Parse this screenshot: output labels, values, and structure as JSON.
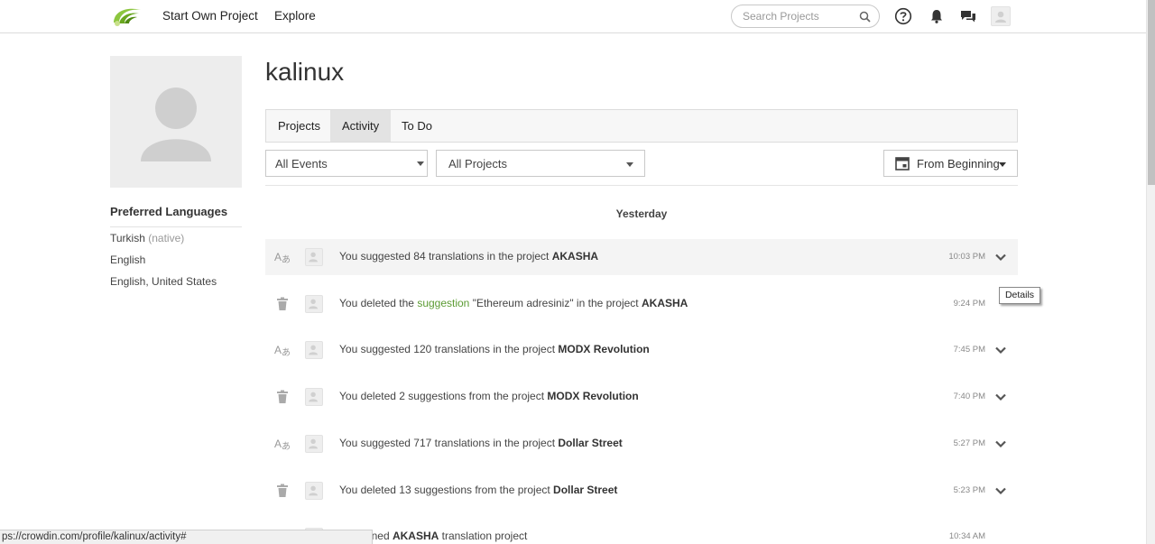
{
  "topbar": {
    "logo_icon": "crowdin-logo-icon",
    "nav": [
      "Start Own Project",
      "Explore"
    ],
    "search_placeholder": "Search Projects",
    "icons": [
      "help-icon",
      "bell-icon",
      "chat-icon"
    ]
  },
  "sidebar": {
    "preferred_languages_title": "Preferred Languages",
    "languages": [
      {
        "name": "Turkish",
        "note": "(native)"
      },
      {
        "name": "English",
        "note": ""
      },
      {
        "name": "English, United States",
        "note": ""
      }
    ]
  },
  "main": {
    "username": "kalinux",
    "tabs": [
      {
        "label": "Projects",
        "active": false
      },
      {
        "label": "Activity",
        "active": true
      },
      {
        "label": "To Do",
        "active": false
      }
    ],
    "filters": {
      "events": "All Events",
      "projects": "All Projects",
      "date": "From Beginning"
    },
    "day_label": "Yesterday",
    "activity": [
      {
        "icon": "translate-icon",
        "parts": [
          [
            "You suggested 84 translations in the project ",
            "t"
          ],
          [
            "AKASHA",
            "b"
          ]
        ],
        "time": "10:03 PM",
        "expand": true,
        "highlight": true
      },
      {
        "icon": "trash-icon",
        "parts": [
          [
            "You deleted the ",
            "t"
          ],
          [
            "suggestion",
            "l"
          ],
          [
            " \"Ethereum adresiniz\" in the project ",
            "t"
          ],
          [
            "AKASHA",
            "b"
          ]
        ],
        "time": "9:24 PM",
        "expand": false,
        "highlight": false
      },
      {
        "icon": "translate-icon",
        "parts": [
          [
            "You suggested 120 translations in the project ",
            "t"
          ],
          [
            "MODX Revolution",
            "b"
          ]
        ],
        "time": "7:45 PM",
        "expand": true,
        "highlight": false
      },
      {
        "icon": "trash-icon",
        "parts": [
          [
            "You deleted 2 suggestions from the project ",
            "t"
          ],
          [
            "MODX Revolution",
            "b"
          ]
        ],
        "time": "7:40 PM",
        "expand": true,
        "highlight": false
      },
      {
        "icon": "translate-icon",
        "parts": [
          [
            "You suggested 717 translations in the project ",
            "t"
          ],
          [
            "Dollar Street",
            "b"
          ]
        ],
        "time": "5:27 PM",
        "expand": true,
        "highlight": false
      },
      {
        "icon": "trash-icon",
        "parts": [
          [
            "You deleted 13 suggestions from the project ",
            "t"
          ],
          [
            "Dollar Street",
            "b"
          ]
        ],
        "time": "5:23 PM",
        "expand": true,
        "highlight": false
      },
      {
        "icon": "join-icon",
        "parts": [
          [
            "You joined ",
            "t"
          ],
          [
            "AKASHA",
            "b"
          ],
          [
            " translation project",
            "t"
          ]
        ],
        "time": "10:34 AM",
        "expand": false,
        "highlight": false
      }
    ]
  },
  "tooltip": "Details",
  "status_url": "ps://crowdin.com/profile/kalinux/activity#"
}
